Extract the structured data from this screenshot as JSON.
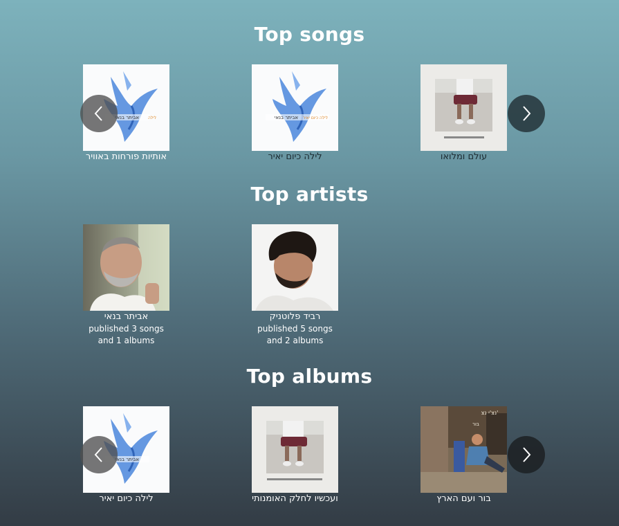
{
  "sections": {
    "songs": {
      "title": "Top songs",
      "items": [
        {
          "title": "אותיות פורחות באוויר",
          "art": "bird-album-art"
        },
        {
          "title": "לילה כיום יאיר",
          "art": "bird-album-art"
        },
        {
          "title": "עולם ומלואו",
          "art": "feet-album-art"
        }
      ]
    },
    "artists": {
      "title": "Top artists",
      "items": [
        {
          "name": "אביתר בנאי",
          "line1": "published 3 songs",
          "line2": "and 1 albums",
          "photo": "artist-photo-gray-beard"
        },
        {
          "name": "רביד פלוטניק",
          "line1": "published 5 songs",
          "line2": "and 2 albums",
          "photo": "artist-photo-curly-hair"
        }
      ]
    },
    "albums": {
      "title": "Top albums",
      "items": [
        {
          "title": "לילה כיום יאיר",
          "art": "bird-album-art"
        },
        {
          "title": "ועכשיו לחלק האומנותי",
          "art": "feet-album-art"
        },
        {
          "title": "בור ועם הארץ",
          "art": "street-album-art"
        }
      ]
    }
  },
  "colors": {
    "bird_blue": "#3f7fd6",
    "accent_text": "#ffffff"
  }
}
